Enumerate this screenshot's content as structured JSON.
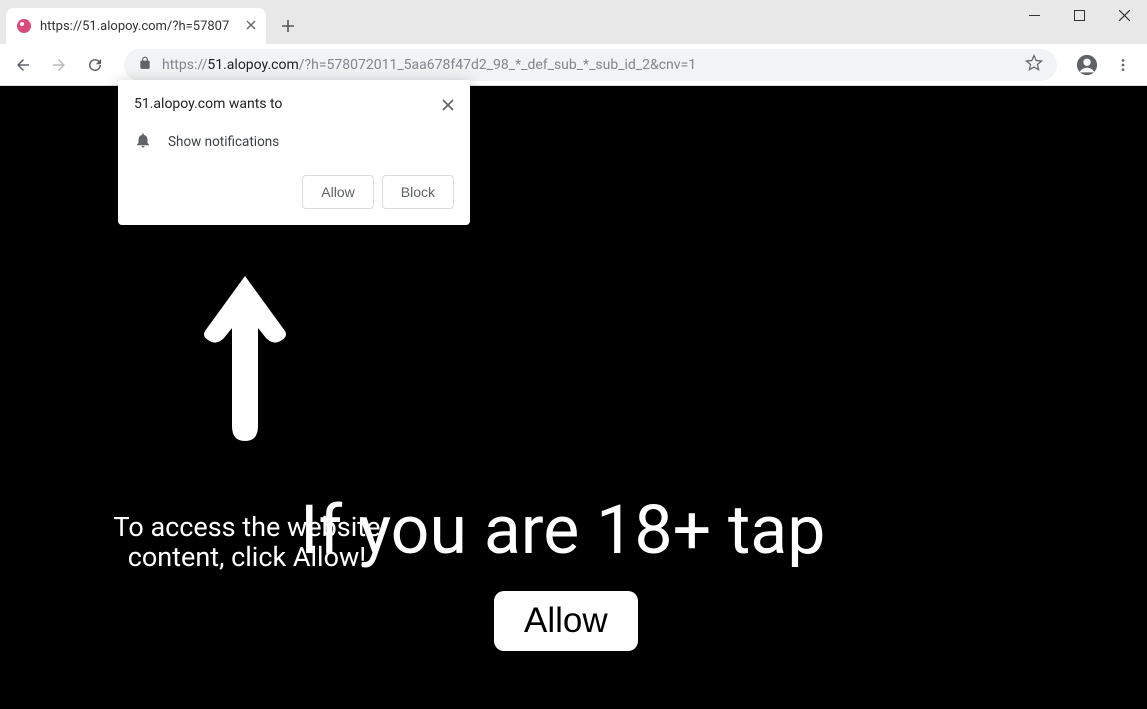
{
  "window": {},
  "tab": {
    "title": "https://51.alopoy.com/?h=57807"
  },
  "omnibox": {
    "scheme": "https://",
    "host": "51.alopoy.com",
    "path": "/?h=578072011_5aa678f47d2_98_*_def_sub_*_sub_id_2&cnv=1"
  },
  "content": {
    "line1": "To access the website content, click Allow!",
    "line2": "If you are 18+ tap",
    "fake_button": "Allow"
  },
  "perm": {
    "title": "51.alopoy.com wants to",
    "item": "Show notifications",
    "allow": "Allow",
    "block": "Block"
  }
}
